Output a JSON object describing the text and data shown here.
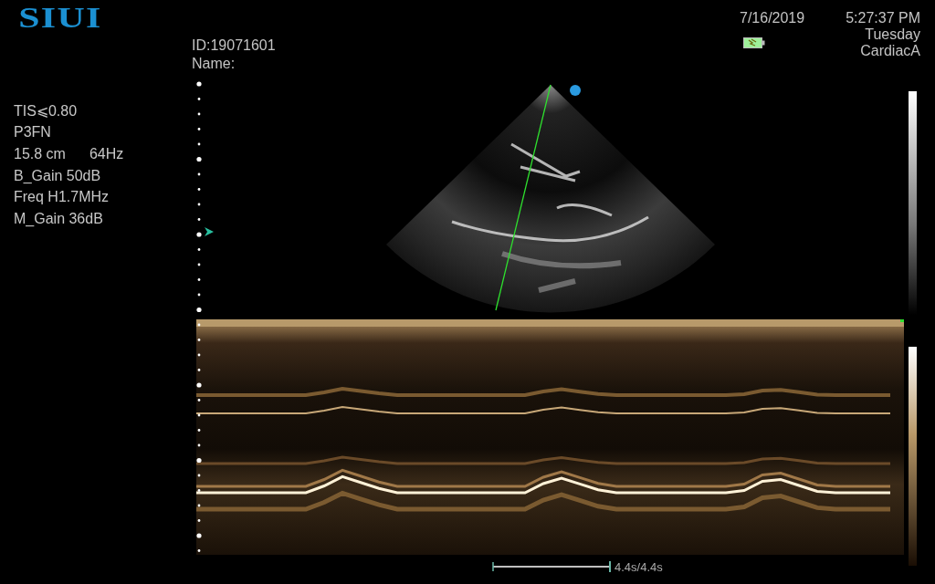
{
  "brand": {
    "logo": "SIUI"
  },
  "patient": {
    "id": "ID:19071601",
    "name": "Name:"
  },
  "status": {
    "date": "7/16/2019",
    "time": "5:27:37 PM",
    "day": "Tuesday",
    "preset": "CardiacA"
  },
  "parameters": [
    [
      "TIS⩽0.80"
    ],
    [
      "P3FN"
    ],
    [
      "15.8 cm",
      "64Hz"
    ],
    [
      "B_Gain 50dB"
    ],
    [
      "Freq H1.7MHz"
    ],
    [
      "M_Gain 36dB"
    ]
  ],
  "timeline": {
    "sweep": "4.4s/4.4s"
  }
}
